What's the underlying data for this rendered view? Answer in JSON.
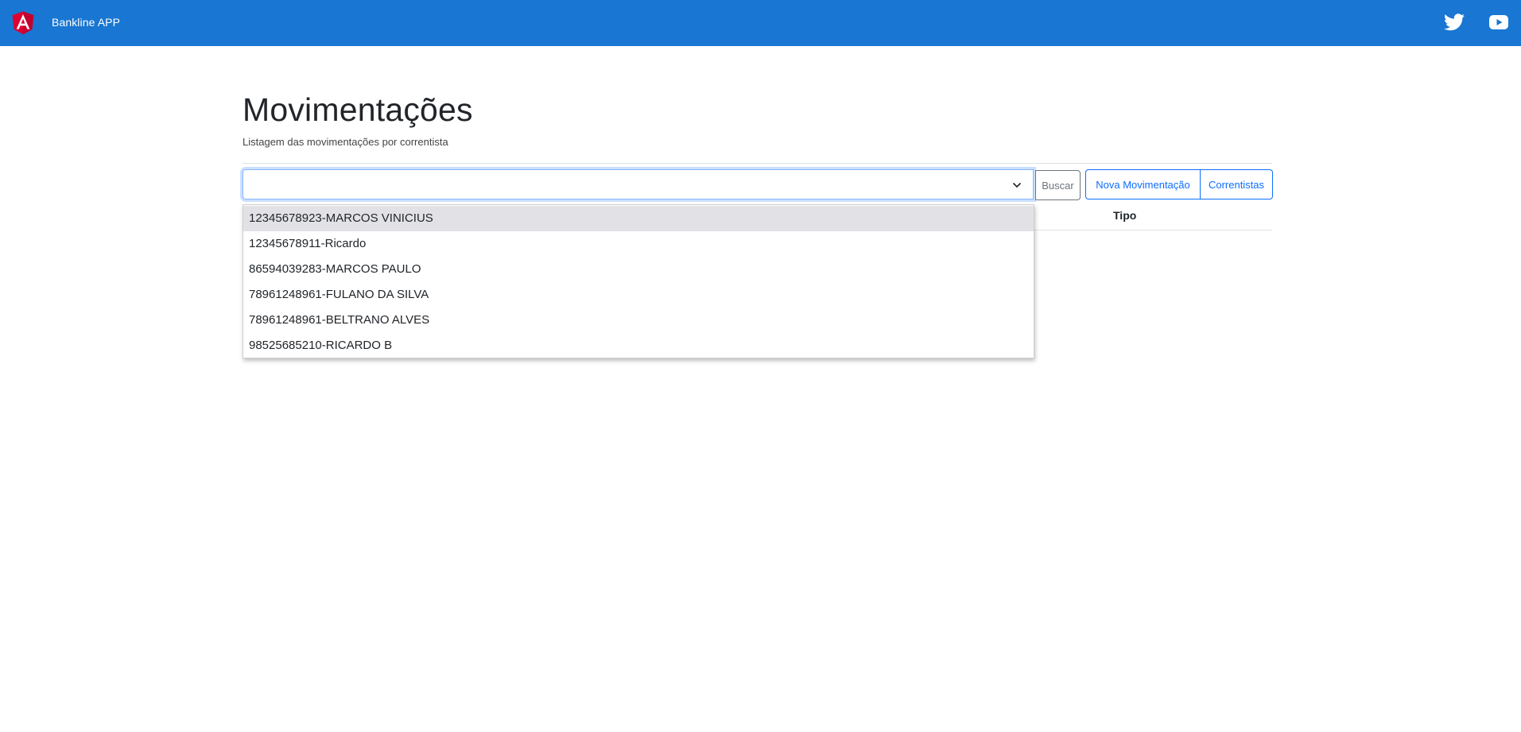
{
  "header": {
    "app_title": "Bankline APP",
    "brand_color": "#1976d2",
    "logo_icon": "angular-logo",
    "social_icons": [
      "twitter-icon",
      "youtube-icon"
    ]
  },
  "page": {
    "title": "Movimentações",
    "subtitle": "Listagem das movimentações por correntista"
  },
  "filter": {
    "selected_value": "",
    "search_label": "Buscar",
    "options": [
      {
        "label": "12345678923-MARCOS VINICIUS"
      },
      {
        "label": "12345678911-Ricardo"
      },
      {
        "label": "86594039283-MARCOS PAULO"
      },
      {
        "label": "78961248961-FULANO DA SILVA"
      },
      {
        "label": "78961248961-BELTRANO ALVES"
      },
      {
        "label": "98525685210-RICARDO B"
      }
    ],
    "highlighted_index": 0
  },
  "actions": {
    "new_label": "Nova Movimentação",
    "accounts_label": "Correntistas"
  },
  "table": {
    "headers": [
      "Tipo"
    ]
  },
  "colors": {
    "primary": "#0d6efd",
    "secondary": "#6c757d",
    "highlight": "#e2e2e6"
  }
}
